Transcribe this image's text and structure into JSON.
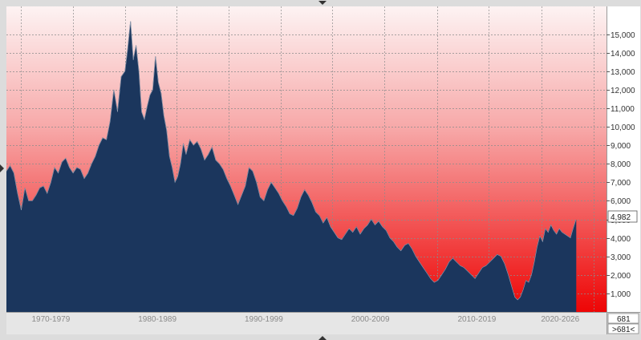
{
  "chart_data": {
    "type": "area",
    "title": "",
    "xlabel": "",
    "ylabel": "",
    "ylim": [
      0,
      16500
    ],
    "xlim": [
      1965.2,
      2030.0
    ],
    "y_ticks": [
      {
        "value": 1000,
        "label": "1,000"
      },
      {
        "value": 2000,
        "label": "2,000"
      },
      {
        "value": 3000,
        "label": "3,000"
      },
      {
        "value": 4000,
        "label": "4,000"
      },
      {
        "value": 5000,
        "label": "5,000"
      },
      {
        "value": 6000,
        "label": "6,000"
      },
      {
        "value": 7000,
        "label": "7,000"
      },
      {
        "value": 8000,
        "label": "8,000"
      },
      {
        "value": 9000,
        "label": "9,000"
      },
      {
        "value": 10000,
        "label": "10,000"
      },
      {
        "value": 11000,
        "label": "11,000"
      },
      {
        "value": 12000,
        "label": "12,000"
      },
      {
        "value": 13000,
        "label": "13,000"
      },
      {
        "value": 14000,
        "label": "14,000"
      },
      {
        "value": 15000,
        "label": "15,000"
      }
    ],
    "x_ticks": [
      {
        "value": 1970.0,
        "label": "1970-1979"
      },
      {
        "value": 1981.5,
        "label": "1980-1989"
      },
      {
        "value": 1993.0,
        "label": "1990-1999"
      },
      {
        "value": 2004.5,
        "label": "2000-2009"
      },
      {
        "value": 2016.0,
        "label": "2010-2019"
      },
      {
        "value": 2025.0,
        "label": "2020-2026"
      }
    ],
    "x_gridlines": [
      1966.8,
      1972.4,
      1978.0,
      1983.6,
      1989.2,
      1994.8,
      2000.4,
      2006.0,
      2011.7,
      2017.3,
      2023.0,
      2028.6
    ],
    "grid": true,
    "series": [
      {
        "points": [
          [
            1965.2,
            7600
          ],
          [
            1965.6,
            7900
          ],
          [
            1966.0,
            7500
          ],
          [
            1966.4,
            6400
          ],
          [
            1966.8,
            5500
          ],
          [
            1967.2,
            6700
          ],
          [
            1967.6,
            6000
          ],
          [
            1968.0,
            6000
          ],
          [
            1968.4,
            6300
          ],
          [
            1968.8,
            6700
          ],
          [
            1969.2,
            6800
          ],
          [
            1969.6,
            6400
          ],
          [
            1970.0,
            7000
          ],
          [
            1970.4,
            7800
          ],
          [
            1970.8,
            7500
          ],
          [
            1971.2,
            8100
          ],
          [
            1971.6,
            8300
          ],
          [
            1972.0,
            7800
          ],
          [
            1972.4,
            7500
          ],
          [
            1972.8,
            7800
          ],
          [
            1973.2,
            7700
          ],
          [
            1973.6,
            7200
          ],
          [
            1974.0,
            7500
          ],
          [
            1974.4,
            8000
          ],
          [
            1974.8,
            8400
          ],
          [
            1975.2,
            9000
          ],
          [
            1975.6,
            9400
          ],
          [
            1976.0,
            9300
          ],
          [
            1976.4,
            10300
          ],
          [
            1976.8,
            12000
          ],
          [
            1977.2,
            10800
          ],
          [
            1977.6,
            12700
          ],
          [
            1978.0,
            13000
          ],
          [
            1978.3,
            14200
          ],
          [
            1978.6,
            15700
          ],
          [
            1978.9,
            13600
          ],
          [
            1979.2,
            14400
          ],
          [
            1979.5,
            13000
          ],
          [
            1979.8,
            10800
          ],
          [
            1980.1,
            10400
          ],
          [
            1980.4,
            11100
          ],
          [
            1980.7,
            11700
          ],
          [
            1981.0,
            12000
          ],
          [
            1981.3,
            13800
          ],
          [
            1981.6,
            12400
          ],
          [
            1981.9,
            11800
          ],
          [
            1982.2,
            10600
          ],
          [
            1982.5,
            9800
          ],
          [
            1982.8,
            8400
          ],
          [
            1983.1,
            7800
          ],
          [
            1983.4,
            7000
          ],
          [
            1983.7,
            7300
          ],
          [
            1984.0,
            8000
          ],
          [
            1984.3,
            9100
          ],
          [
            1984.6,
            8500
          ],
          [
            1985.0,
            9300
          ],
          [
            1985.4,
            9000
          ],
          [
            1985.8,
            9200
          ],
          [
            1986.2,
            8800
          ],
          [
            1986.6,
            8200
          ],
          [
            1987.0,
            8500
          ],
          [
            1987.4,
            8900
          ],
          [
            1987.8,
            8200
          ],
          [
            1988.2,
            8000
          ],
          [
            1988.6,
            7700
          ],
          [
            1989.0,
            7200
          ],
          [
            1989.4,
            6800
          ],
          [
            1989.8,
            6300
          ],
          [
            1990.2,
            5800
          ],
          [
            1990.6,
            6300
          ],
          [
            1991.0,
            6800
          ],
          [
            1991.4,
            7800
          ],
          [
            1991.8,
            7600
          ],
          [
            1992.2,
            7000
          ],
          [
            1992.6,
            6200
          ],
          [
            1993.0,
            6000
          ],
          [
            1993.4,
            6600
          ],
          [
            1993.8,
            7000
          ],
          [
            1994.2,
            6700
          ],
          [
            1994.6,
            6400
          ],
          [
            1995.0,
            6000
          ],
          [
            1995.4,
            5700
          ],
          [
            1995.8,
            5300
          ],
          [
            1996.2,
            5200
          ],
          [
            1996.6,
            5600
          ],
          [
            1997.0,
            6200
          ],
          [
            1997.4,
            6600
          ],
          [
            1997.8,
            6300
          ],
          [
            1998.2,
            5900
          ],
          [
            1998.6,
            5400
          ],
          [
            1999.0,
            5200
          ],
          [
            1999.4,
            4800
          ],
          [
            1999.8,
            5100
          ],
          [
            2000.2,
            4600
          ],
          [
            2000.6,
            4300
          ],
          [
            2001.0,
            4000
          ],
          [
            2001.4,
            3900
          ],
          [
            2001.8,
            4200
          ],
          [
            2002.2,
            4500
          ],
          [
            2002.6,
            4300
          ],
          [
            2003.0,
            4600
          ],
          [
            2003.4,
            4200
          ],
          [
            2003.8,
            4500
          ],
          [
            2004.2,
            4700
          ],
          [
            2004.6,
            5000
          ],
          [
            2005.0,
            4700
          ],
          [
            2005.4,
            4900
          ],
          [
            2005.8,
            4600
          ],
          [
            2006.2,
            4400
          ],
          [
            2006.6,
            4000
          ],
          [
            2007.0,
            3800
          ],
          [
            2007.4,
            3500
          ],
          [
            2007.8,
            3300
          ],
          [
            2008.2,
            3600
          ],
          [
            2008.6,
            3700
          ],
          [
            2009.0,
            3400
          ],
          [
            2009.4,
            3000
          ],
          [
            2009.8,
            2700
          ],
          [
            2010.2,
            2400
          ],
          [
            2010.6,
            2100
          ],
          [
            2011.0,
            1800
          ],
          [
            2011.4,
            1600
          ],
          [
            2011.8,
            1700
          ],
          [
            2012.2,
            2000
          ],
          [
            2012.6,
            2300
          ],
          [
            2013.0,
            2700
          ],
          [
            2013.4,
            2900
          ],
          [
            2013.8,
            2700
          ],
          [
            2014.2,
            2500
          ],
          [
            2014.6,
            2400
          ],
          [
            2015.0,
            2200
          ],
          [
            2015.4,
            2000
          ],
          [
            2015.8,
            1800
          ],
          [
            2016.2,
            2100
          ],
          [
            2016.6,
            2400
          ],
          [
            2017.0,
            2500
          ],
          [
            2017.4,
            2700
          ],
          [
            2017.8,
            2900
          ],
          [
            2018.2,
            3100
          ],
          [
            2018.6,
            3000
          ],
          [
            2019.0,
            2600
          ],
          [
            2019.4,
            2000
          ],
          [
            2019.8,
            1300
          ],
          [
            2020.1,
            800
          ],
          [
            2020.4,
            650
          ],
          [
            2020.7,
            800
          ],
          [
            2021.0,
            1200
          ],
          [
            2021.3,
            1700
          ],
          [
            2021.6,
            1600
          ],
          [
            2021.9,
            2000
          ],
          [
            2022.2,
            2700
          ],
          [
            2022.5,
            3500
          ],
          [
            2022.8,
            4100
          ],
          [
            2023.1,
            3800
          ],
          [
            2023.4,
            4500
          ],
          [
            2023.7,
            4300
          ],
          [
            2024.0,
            4700
          ],
          [
            2024.3,
            4400
          ],
          [
            2024.6,
            4200
          ],
          [
            2024.9,
            4500
          ],
          [
            2025.2,
            4300
          ],
          [
            2025.5,
            4200
          ],
          [
            2025.8,
            4100
          ],
          [
            2026.1,
            4000
          ],
          [
            2026.4,
            4500
          ],
          [
            2026.7,
            4982
          ]
        ]
      }
    ],
    "last_value_label": "4,982",
    "corner_label_top": "681",
    "corner_label_bottom": ">681<",
    "colors": {
      "fill": "#1b365d",
      "bg_top": "#fdf3f3",
      "bg_bottom": "#ee0505",
      "gridline": "#8c8c8c"
    }
  }
}
